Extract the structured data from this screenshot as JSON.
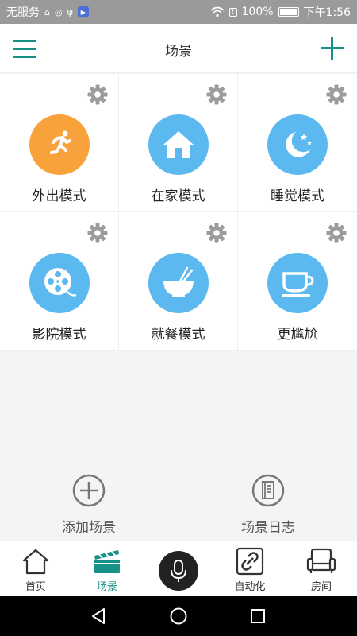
{
  "status_bar": {
    "carrier": "无服务",
    "battery_percent": "100%",
    "time": "下午1:56"
  },
  "header": {
    "title": "场景"
  },
  "scenes": [
    {
      "label": "外出模式",
      "color": "#f7a23b",
      "icon": "running-person-icon"
    },
    {
      "label": "在家模式",
      "color": "#5bb9f0",
      "icon": "house-icon"
    },
    {
      "label": "睡觉模式",
      "color": "#5bb9f0",
      "icon": "moon-stars-icon"
    },
    {
      "label": "影院模式",
      "color": "#5bb9f0",
      "icon": "film-reel-icon"
    },
    {
      "label": "就餐模式",
      "color": "#5bb9f0",
      "icon": "bowl-chopsticks-icon"
    },
    {
      "label": "更尴尬",
      "color": "#5bb9f0",
      "icon": "teacup-icon"
    }
  ],
  "actions": {
    "add_scene": "添加场景",
    "scene_log": "场景日志"
  },
  "bottom_nav": {
    "home": "首页",
    "scene": "场景",
    "automation": "自动化",
    "room": "房间"
  },
  "colors": {
    "accent": "#159187",
    "status_bar": "#9a9a9a",
    "scene_blue": "#5bb9f0",
    "scene_orange": "#f7a23b"
  }
}
